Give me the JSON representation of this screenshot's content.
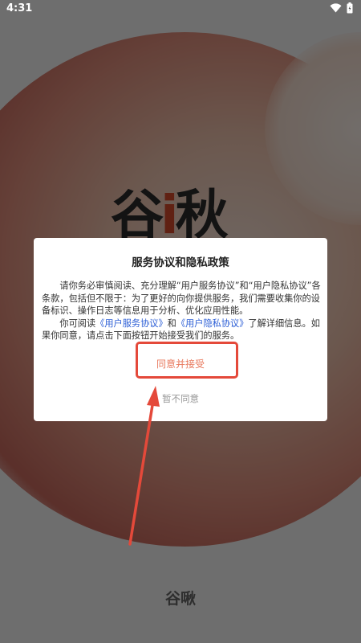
{
  "status_bar": {
    "time": "4:31",
    "icons": [
      "wifi-icon",
      "battery-icon"
    ]
  },
  "splash": {
    "logo_prefix": "谷",
    "logo_accent": "i",
    "logo_suffix": "秋",
    "app_name": "谷啾"
  },
  "dialog": {
    "title": "服务协议和隐私政策",
    "paragraph1": "请你务必审慎阅读、充分理解“用户服务协议”和“用户隐私协议”各条款，包括但不限于：为了更好的向你提供服务，我们需要收集你的设备标识、操作日志等信息用于分析、优化应用性能。",
    "paragraph2_prefix": "你可阅读",
    "service_link": "《用户服务协议》",
    "paragraph2_and": "和",
    "privacy_link": "《用户隐私协议》",
    "paragraph2_suffix": "了解详细信息。如果你同意，请点击下面按钮开始接受我们的服务。",
    "agree_label": "同意并接受",
    "disagree_label": "暂不同意"
  },
  "colors": {
    "accent_agree": "#e8785c",
    "link": "#2d5fd6",
    "annotation": "#e4493a"
  }
}
